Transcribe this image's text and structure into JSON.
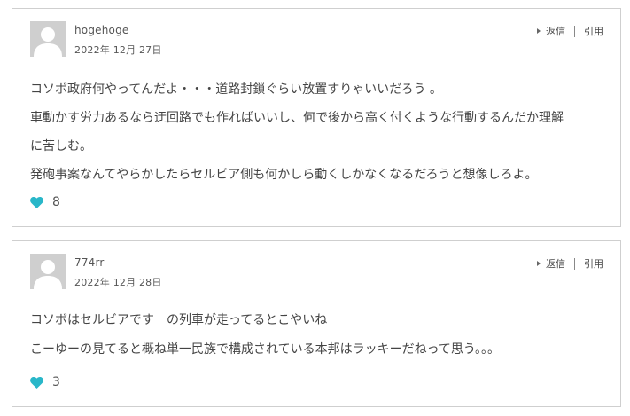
{
  "colors": {
    "heart": "#29b7c9",
    "border": "#cfcfcf",
    "avatar": "#cfcfcf"
  },
  "comments": [
    {
      "author": "hogehoge",
      "date": "2022年 12月 27日",
      "reply_label": "返信",
      "quote_label": "引用",
      "lines": [
        "コソボ政府何やってんだよ・・・道路封鎖ぐらい放置すりゃいいだろう 。",
        "車動かす労力あるなら迂回路でも作ればいいし、何で後から高く付くような行動するんだか理解",
        "に苦しむ。",
        "発砲事案なんてやらかしたらセルビア側も何かしら動くしかなくなるだろうと想像しろよ。"
      ],
      "likes": "8"
    },
    {
      "author": "774rr",
      "date": "2022年 12月 28日",
      "reply_label": "返信",
      "quote_label": "引用",
      "lines": [
        "コソボはセルビアです　の列車が走ってるとこやいね",
        "こーゆーの見てると概ね単一民族で構成されている本邦はラッキーだねって思う。。。"
      ],
      "likes": "3"
    }
  ]
}
